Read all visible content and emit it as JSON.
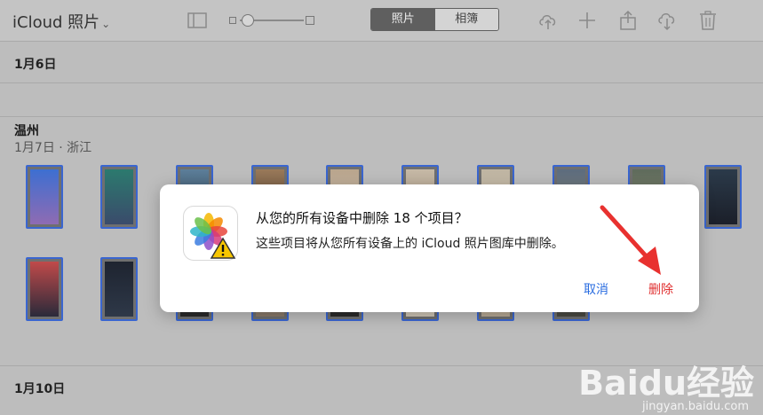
{
  "toolbar": {
    "app_name": "iCloud 照片",
    "chevron": "⌄",
    "segments": {
      "photos": "照片",
      "albums": "相簿"
    },
    "icons": [
      "sidebar-icon",
      "upload-icon",
      "add-icon",
      "share-icon",
      "download-icon",
      "trash-icon"
    ]
  },
  "sections": {
    "first_date": "1月6日",
    "location_title": "温州",
    "location_sub": "1月7日 · 浙江",
    "second_date": "1月10日"
  },
  "dialog": {
    "title": "从您的所有设备中删除 18 个项目？",
    "message": "这些项目将从您所有设备上的 iCloud 照片图库中删除。",
    "cancel_label": "取消",
    "delete_label": "删除"
  },
  "watermark": {
    "logo_text": "Baidu经验",
    "url": "jingyan.baidu.com"
  },
  "colors": {
    "selection_border": "#3a66d0",
    "cancel": "#2a6de0",
    "delete": "#e03030",
    "arrow": "#e8312f"
  }
}
